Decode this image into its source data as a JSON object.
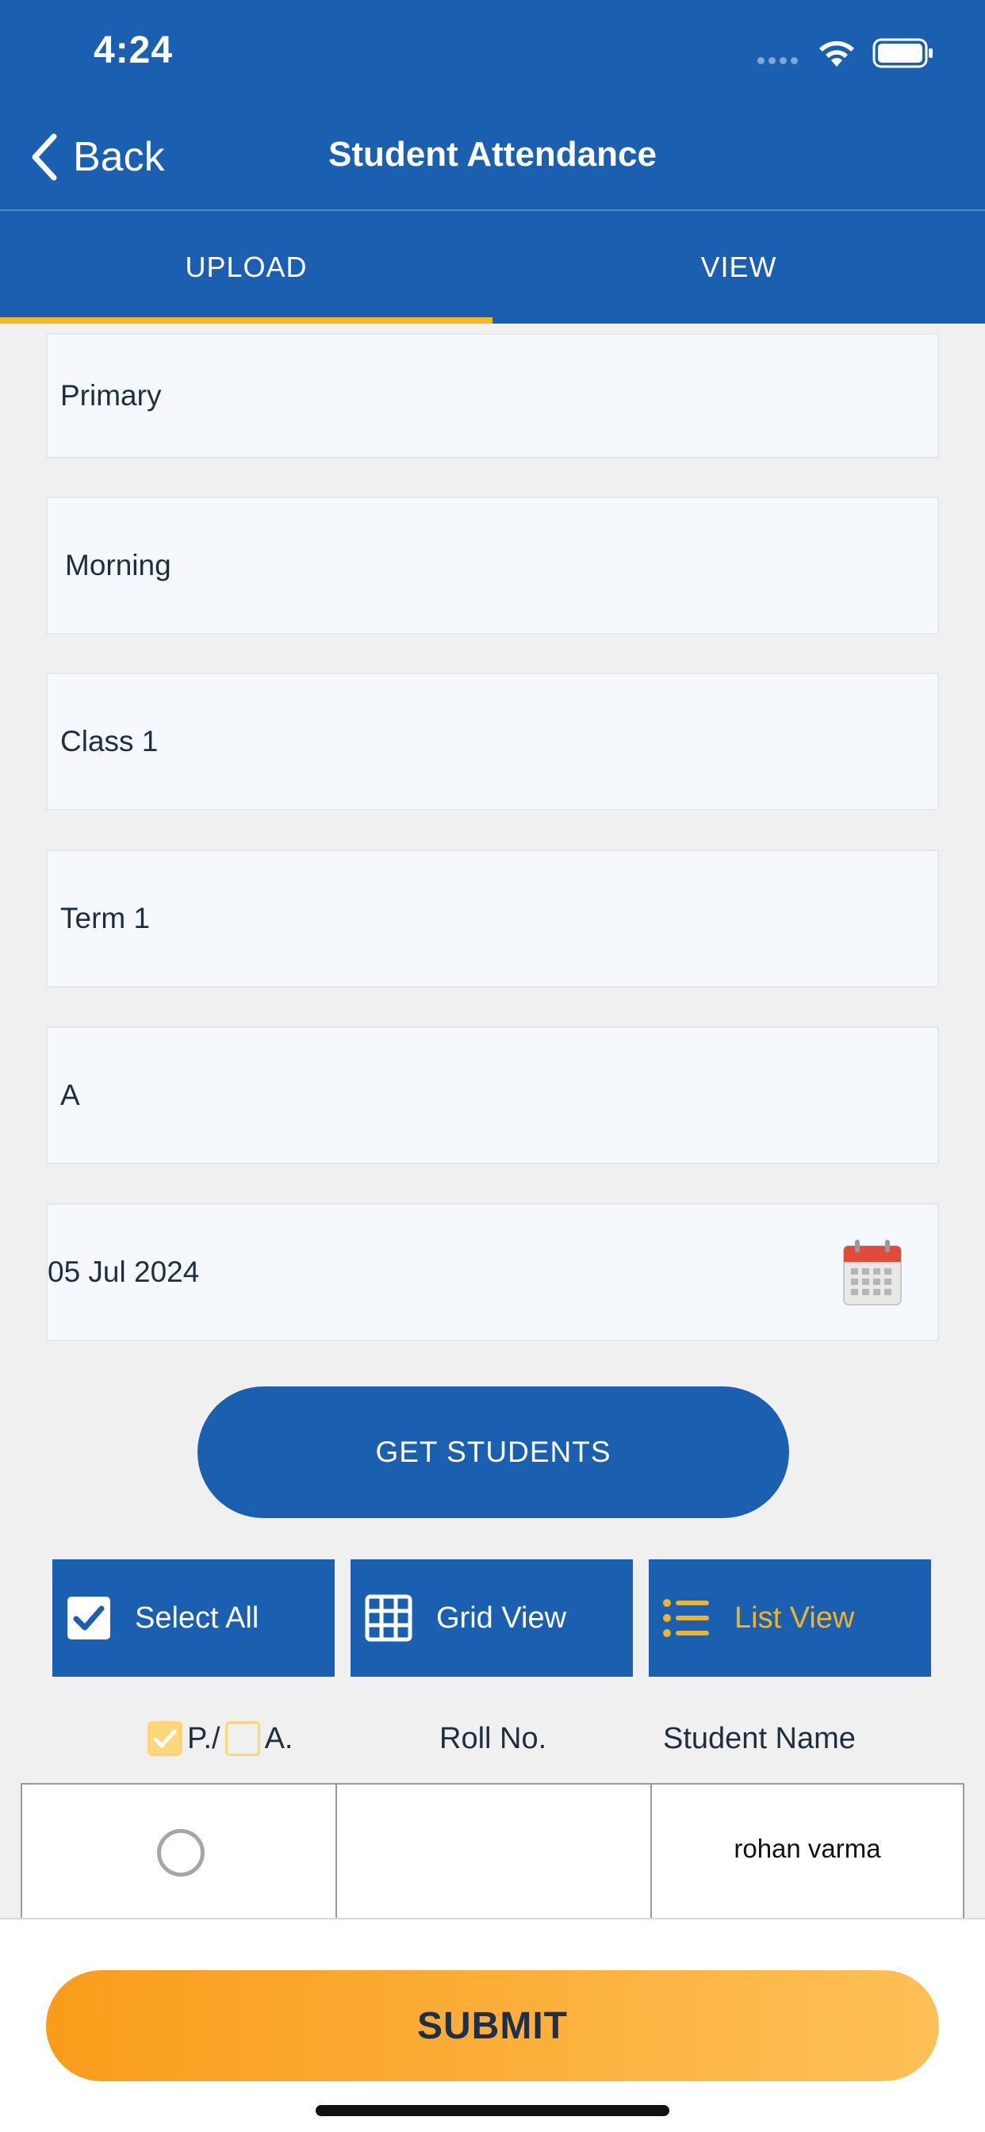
{
  "status_bar": {
    "time": "4:24"
  },
  "nav": {
    "back_label": "Back",
    "title": "Student Attendance"
  },
  "tabs": [
    {
      "label": "UPLOAD",
      "active": true
    },
    {
      "label": "VIEW",
      "active": false
    }
  ],
  "form": {
    "level": "Primary",
    "shift": "Morning",
    "class": "Class 1",
    "term": "Term 1",
    "section": "A",
    "date": "05 Jul 2024"
  },
  "get_students_label": "GET STUDENTS",
  "options": {
    "select_all": "Select All",
    "grid_view": "Grid View",
    "list_view": "List View"
  },
  "table": {
    "headers": {
      "present": "P./",
      "absent": "A.",
      "roll": "Roll No.",
      "name": "Student Name"
    },
    "rows": [
      {
        "roll": "",
        "name": "rohan varma"
      }
    ]
  },
  "submit_label": "SUBMIT",
  "colors": {
    "primary": "#1b5fb0",
    "accent": "#f5b820",
    "submit_start": "#f99c1a",
    "submit_end": "#fec057"
  }
}
